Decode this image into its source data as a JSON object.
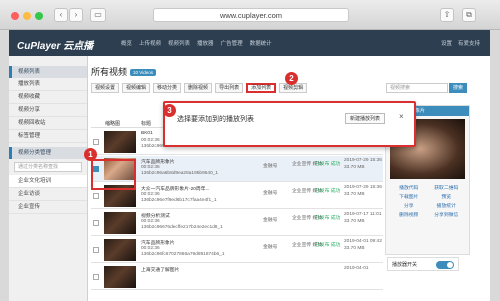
{
  "browser": {
    "url": "www.cuplayer.com"
  },
  "app": {
    "logo": "CuPlayer 云点播",
    "nav": [
      "概览",
      "上传视频",
      "视频列表",
      "播放器",
      "广告管理",
      "数据统计"
    ],
    "settings": "设置",
    "user": "有爱支持"
  },
  "sidebar": {
    "group1": "视频列表",
    "items": [
      "播放列表",
      "视频收藏",
      "视频分享",
      "视频回收站",
      "标签管理"
    ],
    "group2": "视频分类管理",
    "search_placeholder": "通过分类名称查找",
    "categories": [
      "企业文化培训",
      "企业访谈",
      "企业宣传"
    ]
  },
  "main": {
    "title": "所有视频",
    "count_badge": "10 Videos",
    "toolbar": [
      "视频设置",
      "视频编辑",
      "移动分类",
      "删除视频",
      "导出列表",
      "添加列表",
      "视频剪辑"
    ],
    "search_placeholder": "视频搜索",
    "search_btn": "搜索",
    "columns": [
      "缩略图",
      "标题",
      "分类",
      "状态",
      "时间"
    ]
  },
  "rows": [
    {
      "title": "BK01",
      "duration": "00:02:36",
      "id": "136b2c9667e7b73c4ce5b...",
      "category": "",
      "type": "",
      "status": "",
      "date": "",
      "size": ""
    },
    {
      "title": "汽车品牌形象片",
      "duration": "00:02:36",
      "id": "136b2c96a6b8d9ea28a195b9540_1",
      "category": "金融号",
      "type": "企业宣传 媒体",
      "status": "已发布 成功",
      "date": "2019-07-29 15:36",
      "size": "33.70 MB"
    },
    {
      "title": "大众一汽车品牌形象片-20周年...",
      "duration": "00:02:36",
      "id": "136b2c96e7f9ed6b17c7faa4e4f1_1",
      "category": "金融号",
      "type": "企业宣传 媒体",
      "status": "已发布 成功",
      "date": "2019-07-29 15:36",
      "size": "33.70 MB"
    },
    {
      "title": "视频分析测试",
      "duration": "00:02:36",
      "id": "136b2c96676decffe217b24e2ec1d8_1",
      "category": "金融号",
      "type": "企业宣传 媒体",
      "status": "已发布 成功",
      "date": "2019-07-17 11:01",
      "size": "33.70 MB"
    },
    {
      "title": "汽车品牌形象片",
      "duration": "00:02:36",
      "id": "136b2c96fc67027866a79d891874b6_1",
      "category": "金融号",
      "type": "企业宣传 媒体",
      "status": "已发布 成功",
      "date": "2019-04-01 09:42",
      "size": "33.70 MB"
    },
    {
      "title": "上海交通了解图片",
      "duration": "",
      "id": "",
      "category": "",
      "type": "",
      "status": "",
      "date": "2019-04-01",
      "size": ""
    }
  ],
  "right_panel": {
    "header": "汽车品牌形象片",
    "links": [
      "播放代码",
      "获取二维码",
      "下载图片",
      "预览",
      "分享",
      "播放统计",
      "删除视频",
      "分享到微信"
    ],
    "toggle_label": "播放器开关"
  },
  "modal": {
    "title": "选择要添加到的播放列表",
    "new_btn": "新建播放列表",
    "close": "×"
  },
  "callouts": [
    "1",
    "2",
    "3"
  ],
  "colors": {
    "accent": "#d9302f",
    "header": "#2c3e50",
    "primary": "#3c8dbc"
  }
}
